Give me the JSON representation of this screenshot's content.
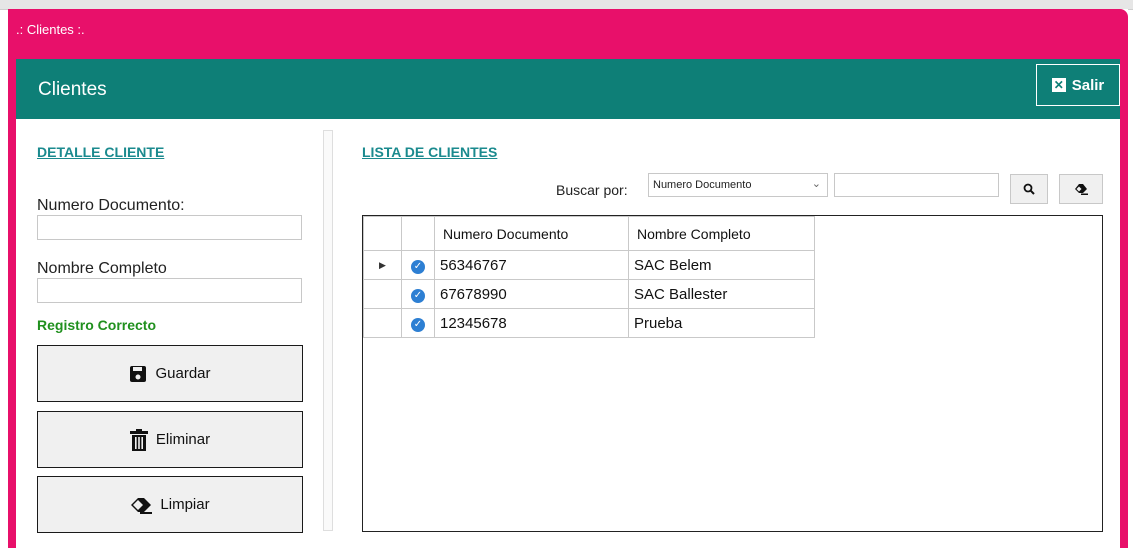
{
  "window": {
    "title": ".: Clientes :."
  },
  "header": {
    "title": "Clientes",
    "exit_label": "Salir",
    "exit_icon": "close-box-icon"
  },
  "detail": {
    "section_title": "DETALLE CLIENTE",
    "doc_label": "Numero Documento:",
    "doc_value": "",
    "name_label": "Nombre Completo",
    "name_value": "",
    "status_text": "Registro Correcto",
    "save_label": "Guardar",
    "delete_label": "Eliminar",
    "clear_label": "Limpiar"
  },
  "list": {
    "section_title": "LISTA DE CLIENTES",
    "search_by_label": "Buscar por:",
    "search_by_selected": "Numero Documento",
    "search_value": "",
    "columns": [
      "Numero Documento",
      "Nombre Completo"
    ],
    "rows": [
      {
        "doc": "56346767",
        "name": "SAC Belem"
      },
      {
        "doc": "67678990",
        "name": "SAC Ballester"
      },
      {
        "doc": "12345678",
        "name": "Prueba"
      }
    ]
  },
  "colors": {
    "titlebar": "#e8106a",
    "header": "#0e7f77",
    "link": "#1a8a8e",
    "status": "#20901e",
    "check": "#2d7fd3"
  }
}
